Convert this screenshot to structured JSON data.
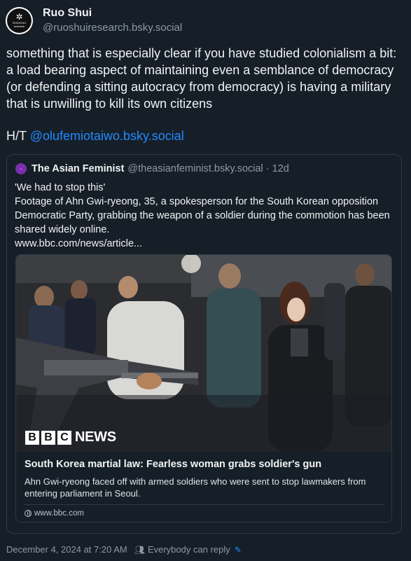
{
  "author": {
    "display_name": "Ruo Shui",
    "handle": "@ruoshuiresearch.bsky.social",
    "avatar_text": "RUOSHUI research"
  },
  "post": {
    "text": "something that is especially clear if you have studied colonialism a bit: a load bearing aspect of maintaining even a semblance of democracy (or defending a sitting autocracy from democracy) is having a military that is unwilling to kill its own citizens",
    "ht_prefix": "H/T",
    "ht_mention": "@olufemiotaiwo.bsky.social"
  },
  "quote": {
    "display_name": "The Asian Feminist",
    "handle": "@theasianfeminist.bsky.social",
    "separator": "·",
    "age": "12d",
    "lines": [
      "'We had to stop this'",
      "Footage of Ahn Gwi-ryeong, 35, a spokesperson for the South Korean opposition Democratic Party, grabbing the weapon of a soldier during the commotion has been shared widely online.",
      "www.bbc.com/news/article..."
    ],
    "card": {
      "brand_letters": [
        "B",
        "B",
        "C"
      ],
      "brand_word": "NEWS",
      "title": "South Korea martial law: Fearless woman grabs soldier's gun",
      "description": "Ahn Gwi-ryeong faced off with armed soldiers who were sent to stop lawmakers from entering parliament in Seoul.",
      "domain": "www.bbc.com"
    }
  },
  "footer": {
    "timestamp": "December 4, 2024 at 7:20 AM",
    "reply_setting": "Everybody can reply"
  },
  "colors": {
    "background": "#161e27",
    "link": "#208bfe",
    "muted": "#8c9aa8",
    "border": "#2e3a47"
  }
}
